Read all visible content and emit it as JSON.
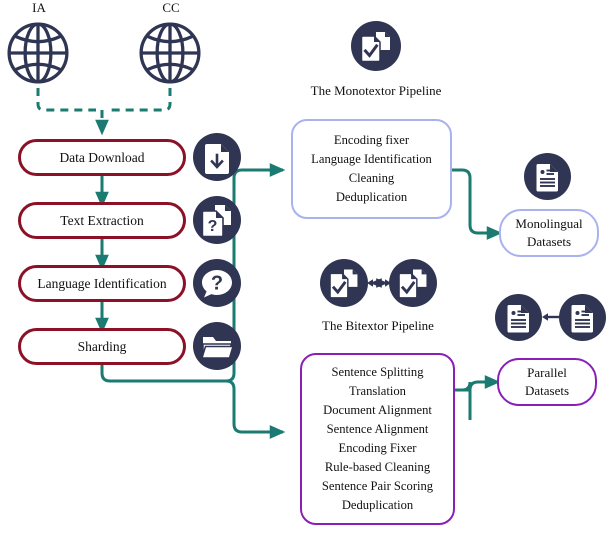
{
  "sources": [
    {
      "label": "IA",
      "icon": "globe-icon"
    },
    {
      "label": "CC",
      "icon": "globe-icon"
    }
  ],
  "left_pipeline": {
    "steps": [
      {
        "label": "Data Download",
        "icon": "document-download-icon"
      },
      {
        "label": "Text Extraction",
        "icon": "document-question-icon"
      },
      {
        "label": "Language Identification",
        "icon": "speech-question-icon"
      },
      {
        "label": "Sharding",
        "icon": "folder-icon"
      }
    ]
  },
  "monotextor": {
    "icon": "document-check-icon",
    "caption": "The Monotextor Pipeline",
    "steps": [
      "Encoding fixer",
      "Language Identification",
      "Cleaning",
      "Deduplication"
    ],
    "output": {
      "icon": "document-lines-icon",
      "line1": "Monolingual",
      "line2": "Datasets"
    }
  },
  "bitextor": {
    "icon_left": "document-check-icon",
    "icon_right": "document-check-icon",
    "icon_link": "double-arrow-icon",
    "caption": "The Bitextor Pipeline",
    "steps": [
      "Sentence Splitting",
      "Translation",
      "Document Alignment",
      "Sentence Alignment",
      "Encoding Fixer",
      "Rule-based Cleaning",
      "Sentence Pair Scoring",
      "Deduplication"
    ],
    "output": {
      "icon_left": "document-lines-icon",
      "icon_right": "document-lines-icon",
      "icon_link": "double-arrow-icon",
      "line1": "Parallel",
      "line2": "Datasets"
    }
  },
  "colors": {
    "navy": "#2f3553",
    "maroon": "#8b1127",
    "teal": "#1b7a72",
    "periwinkle": "#aab1ef",
    "purple": "#8a1fb8",
    "background": "#ffffff"
  }
}
